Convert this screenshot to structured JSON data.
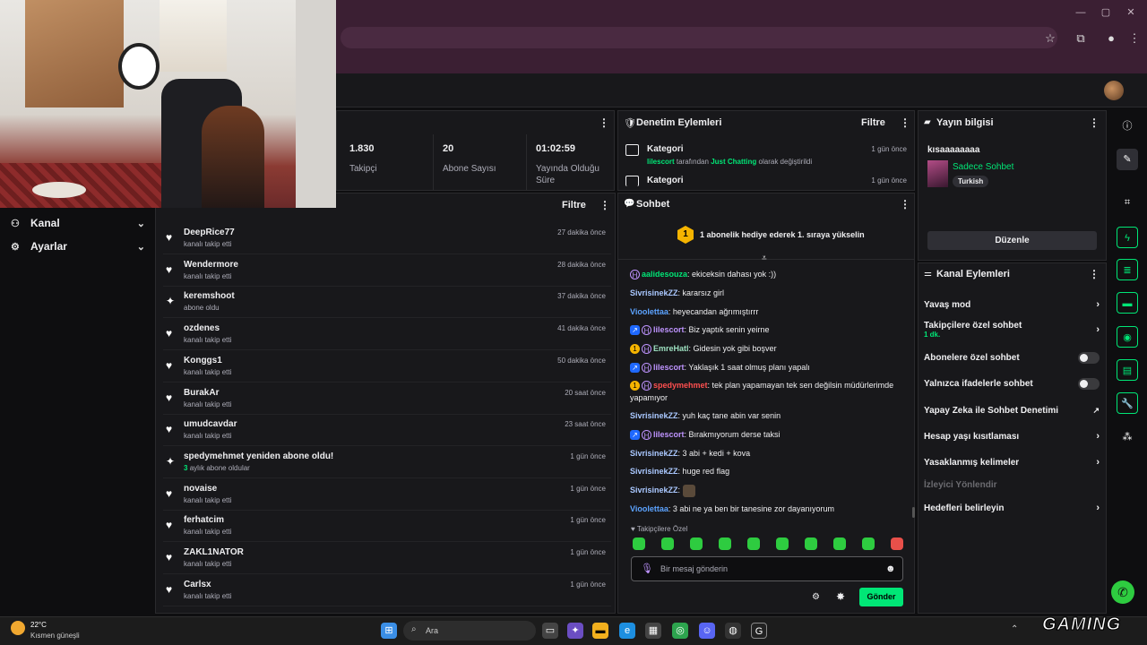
{
  "header": {
    "avatar_alt": "profile"
  },
  "stats": [
    {
      "value": "1.830",
      "label": "Takipçi"
    },
    {
      "value": "20",
      "label": "Abone Sayısı"
    },
    {
      "value": "01:02:59",
      "label": "Yayında Olduğu Süre"
    }
  ],
  "leftnav": {
    "items": [
      {
        "label": "Kanal"
      },
      {
        "label": "Ayarlar"
      }
    ]
  },
  "activity": {
    "filter_label": "Filtre",
    "items": [
      {
        "name": "DeepRice77",
        "desc": "kanalı takip etti",
        "time": "27 dakika önce"
      },
      {
        "name": "Wendermore",
        "desc": "kanalı takip etti",
        "time": "28 dakika önce"
      },
      {
        "name": "keremshoot",
        "desc": "abone oldu",
        "time": "37 dakika önce"
      },
      {
        "name": "ozdenes",
        "desc": "kanalı takip etti",
        "time": "41 dakika önce"
      },
      {
        "name": "Konggs1",
        "desc": "kanalı takip etti",
        "time": "50 dakika önce"
      },
      {
        "name": "BurakAr",
        "desc": "kanalı takip etti",
        "time": "20 saat önce"
      },
      {
        "name": "umudcavdar",
        "desc": "kanalı takip etti",
        "time": "23 saat önce"
      },
      {
        "name": "spedymehmet yeniden abone oldu!",
        "desc_num": "3",
        "desc": "aylık abone oldular",
        "time": "1 gün önce"
      },
      {
        "name": "novaise",
        "desc": "kanalı takip etti",
        "time": "1 gün önce"
      },
      {
        "name": "ferhatcim",
        "desc": "kanalı takip etti",
        "time": "1 gün önce"
      },
      {
        "name": "ZAKL1NATOR",
        "desc": "kanalı takip etti",
        "time": "1 gün önce"
      },
      {
        "name": "Carlsx",
        "desc": "kanalı takip etti",
        "time": "1 gün önce"
      }
    ]
  },
  "moderation": {
    "title": "Denetim Eylemleri",
    "filter_label": "Filtre",
    "items": [
      {
        "title": "Kategori",
        "time": "1 gün önce",
        "user": "lilescort",
        "mid": "tarafından",
        "cat": "Just Chatting",
        "end": "olarak değiştirildi"
      },
      {
        "title": "Kategori",
        "time": "1 gün önce"
      }
    ]
  },
  "chat": {
    "title": "Sohbet",
    "gift_banner": "1 abonelik hediye ederek 1. sıraya yükselin",
    "gift_num": "1",
    "messages": [
      {
        "user": "aalidesouza",
        "text": ": ekiceksin dahası yok :))",
        "color": "#00e676"
      },
      {
        "user": "SivrisinekZZ",
        "text": ": kararsız girl",
        "color": "#aac8ff"
      },
      {
        "user": "Vioolettaa",
        "text": ": heyecandan ağrımıştırrr",
        "color": "#5ca3ff"
      },
      {
        "user": "lilescort",
        "text": ": Biz yaptık senin yeirne",
        "color": "#bf94ff"
      },
      {
        "user": "EmreHatl",
        "text": ": Gidesin yok gibi boşver",
        "color": "#9de0c0"
      },
      {
        "user": "lilescort",
        "text": ": Yaklaşık 1 saat olmuş planı yapalı",
        "color": "#bf94ff"
      },
      {
        "user": "spedymehmet",
        "text": ": tek plan yapamayan tek sen değilsin müdürlerimde yapamıyor",
        "color": "#ff4f4f"
      },
      {
        "user": "SivrisinekZZ",
        "text": ": yuh kaç tane abin var senin",
        "color": "#aac8ff"
      },
      {
        "user": "lilescort",
        "text": ": Bırakmıyorum derse taksi",
        "color": "#bf94ff"
      },
      {
        "user": "SivrisinekZZ",
        "text": ": 3 abi + kedi + kova",
        "color": "#aac8ff"
      },
      {
        "user": "SivrisinekZZ",
        "text": ": huge red flag",
        "color": "#aac8ff"
      },
      {
        "user": "SivrisinekZZ",
        "text": ":",
        "color": "#aac8ff"
      },
      {
        "user": "Vioolettaa",
        "text": ": 3 abi ne ya ben bir tanesine zor dayanıyorum",
        "color": "#5ca3ff"
      }
    ],
    "follower_only_label": "Takipçilere Özel",
    "input_placeholder": "Bir mesaj gönderin",
    "send_label": "Gönder"
  },
  "stream_info": {
    "title": "Yayın bilgisi",
    "stream_title": "kısaaaaaaaa",
    "category": "Sadece Sohbet",
    "tag": "Turkish",
    "edit_label": "Düzenle"
  },
  "channel_actions": {
    "title": "Kanal Eylemleri",
    "items": [
      {
        "label": "Yavaş mod",
        "kind": "chev"
      },
      {
        "label": "Takipçilere özel sohbet",
        "sub": "1 dk.",
        "kind": "chev"
      },
      {
        "label": "Abonelere özel sohbet",
        "kind": "toggle"
      },
      {
        "label": "Yalnızca ifadelerle sohbet",
        "kind": "toggle"
      },
      {
        "label": "Yapay Zeka ile Sohbet Denetimi",
        "kind": "ext"
      },
      {
        "label": "Hesap yaşı kısıtlaması",
        "kind": "chev"
      },
      {
        "label": "Yasaklanmış kelimeler",
        "kind": "chev"
      },
      {
        "label": "İzleyici Yönlendir",
        "kind": "disabled"
      },
      {
        "label": "Hedefleri belirleyin",
        "kind": "chev"
      }
    ]
  },
  "taskbar": {
    "weather_temp": "22°C",
    "weather_desc": "Kısmen güneşli",
    "search_label": "Ara",
    "watermark": "GAMING"
  },
  "colors": {
    "accent": "#00e676",
    "bg": "#0e0e10",
    "panel": "#18181b"
  }
}
